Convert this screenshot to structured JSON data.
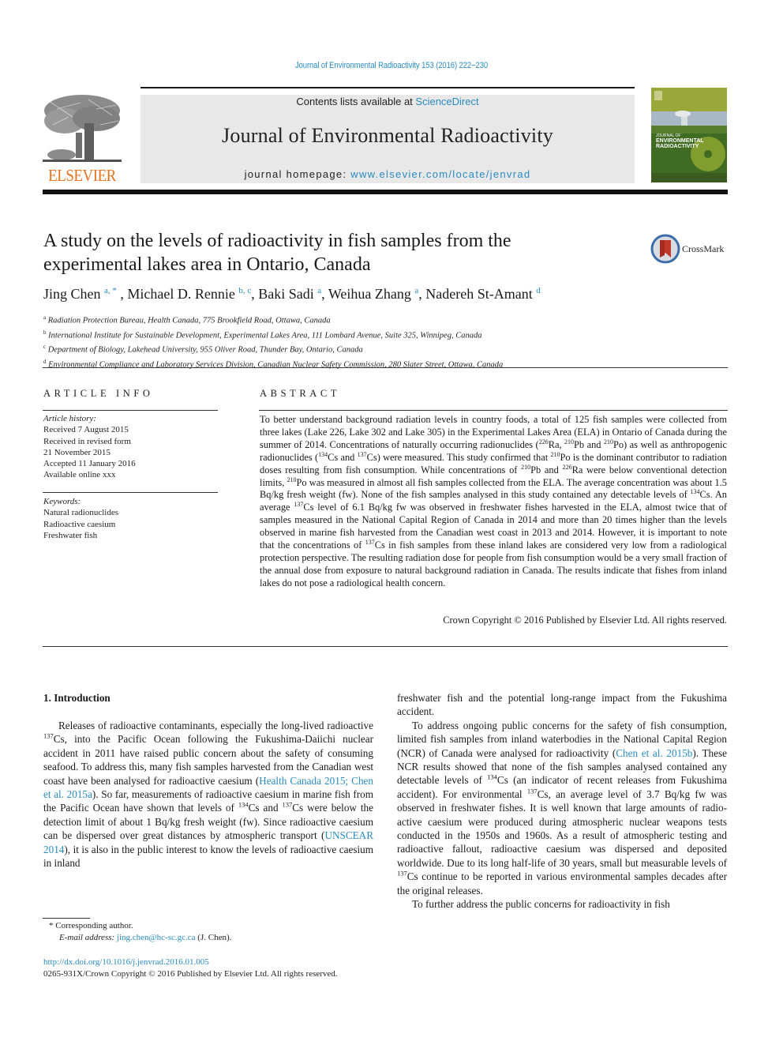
{
  "running_head": "Journal of Environmental Radioactivity 153 (2016) 222−230",
  "header": {
    "publisher_logo_text": "ELSEVIER",
    "contents_prefix": "Contents lists available at ",
    "contents_link": "ScienceDirect",
    "journal_title": "Journal of Environmental Radioactivity",
    "homepage_prefix": "journal homepage: ",
    "homepage_link": "www.elsevier.com/locate/jenvrad",
    "cover_title_line1": "JOURNAL OF",
    "cover_title_line2": "ENVIRONMENTAL",
    "cover_title_line3": "RADIOACTIVITY"
  },
  "article": {
    "title_line1": "A study on the levels of radioactivity in fish samples from the",
    "title_line2": "experimental lakes area in Ontario, Canada",
    "crossmark_label": "CrossMark",
    "authors": [
      {
        "name": "Jing Chen",
        "sup": "a, *"
      },
      {
        "name": "Michael D. Rennie",
        "sup": "b, c"
      },
      {
        "name": "Baki Sadi",
        "sup": "a"
      },
      {
        "name": "Weihua Zhang",
        "sup": "a"
      },
      {
        "name": "Nadereh St-Amant",
        "sup": "d"
      }
    ],
    "affiliations": [
      {
        "key": "a",
        "text": "Radiation Protection Bureau, Health Canada, 775 Brookfield Road, Ottawa, Canada"
      },
      {
        "key": "b",
        "text": "International Institute for Sustainable Development, Experimental Lakes Area, 111 Lombard Avenue, Suite 325, Winnipeg, Canada"
      },
      {
        "key": "c",
        "text": "Department of Biology, Lakehead University, 955 Oliver Road, Thunder Bay, Ontario, Canada"
      },
      {
        "key": "d",
        "text": "Environmental Compliance and Laboratory Services Division, Canadian Nuclear Safety Commission, 280 Slater Street, Ottawa, Canada"
      }
    ]
  },
  "article_info": {
    "heading": "ARTICLE INFO",
    "history_label": "Article history:",
    "history": [
      "Received 7 August 2015",
      "Received in revised form",
      "21 November 2015",
      "Accepted 11 January 2016",
      "Available online xxx"
    ],
    "keywords_label": "Keywords:",
    "keywords": [
      "Natural radionuclides",
      "Radioactive caesium",
      "Freshwater fish"
    ]
  },
  "abstract": {
    "heading": "ABSTRACT",
    "segments": [
      {
        "t": "To better understand background radiation levels in country foods, a total of 125 fish samples were collected from three lakes (Lake 226, Lake 302 and Lake 305) in the Experimental Lakes Area (ELA) in Ontario of Canada during the summer of 2014. Concentrations of naturally occurring radionuclides ("
      },
      {
        "sup": "226"
      },
      {
        "t": "Ra, "
      },
      {
        "sup": "210"
      },
      {
        "t": "Pb and "
      },
      {
        "sup": "210"
      },
      {
        "t": "Po) as well as anthropogenic radionuclides ("
      },
      {
        "sup": "134"
      },
      {
        "t": "Cs and "
      },
      {
        "sup": "137"
      },
      {
        "t": "Cs) were measured. This study confirmed that "
      },
      {
        "sup": "210"
      },
      {
        "t": "Po is the dominant contributor to radiation doses resulting from fish con­sumption. While concentrations of "
      },
      {
        "sup": "210"
      },
      {
        "t": "Pb and "
      },
      {
        "sup": "226"
      },
      {
        "t": "Ra were below conventional detection limits, "
      },
      {
        "sup": "210"
      },
      {
        "t": "Po was measured in almost all fish samples collected from the ELA. The average concentration was about 1.5 Bq/​kg fresh weight (fw). None of the fish samples analysed in this study contained any detectable levels of "
      },
      {
        "sup": "134"
      },
      {
        "t": "Cs. An average "
      },
      {
        "sup": "137"
      },
      {
        "t": "Cs level of 6.1 Bq/kg fw was observed in freshwater fishes harvested in the ELA, almost twice that of samples measured in the National Capital Region of Canada in 2014 and more than 20 times higher than the levels observed in marine fish harvested from the Canadian west coast in 2013 and 2014. However, it is important to note that the concentrations of "
      },
      {
        "sup": "137"
      },
      {
        "t": "Cs in fish samples from these inland lakes are considered very low from a radiological protection perspective. The resulting radiation dose for people from fish consumption would be a very small fraction of the annual dose from exposure to natural background radiation in Canada. The results indicate that fishes from inland lakes do not pose a radiological health concern."
      }
    ],
    "copyright": "Crown Copyright © 2016 Published by Elsevier Ltd. All rights reserved."
  },
  "body": {
    "section_heading": "1.  Introduction",
    "left_paragraphs": [
      [
        {
          "t": "Releases of radioactive contaminants, especially the long-lived radioactive "
        },
        {
          "sup": "137"
        },
        {
          "t": "Cs, into the Pacific Ocean following the Fukushima-Daiichi nuclear accident in 2011 have raised public concern about the safety of consuming seafood. To address this, many fish samples harvested from the Canadian west coast have been analysed for radioactive caesium ("
        },
        {
          "link": "Health Canada 2015; Chen et al. 2015a"
        },
        {
          "t": "). So far, measurements of radioactive caesium in marine fish from the Pa­cific Ocean have shown that levels of "
        },
        {
          "sup": "134"
        },
        {
          "t": "Cs and "
        },
        {
          "sup": "137"
        },
        {
          "t": "Cs were below the detection limit of about 1 Bq/kg fresh weight (fw). Since radioactive caesium can be dispersed over great distances by at­mospheric transport ("
        },
        {
          "link": "UNSCEAR 2014"
        },
        {
          "t": "), it is also in the public in­terest to know the levels of radioactive caesium in inland"
        }
      ]
    ],
    "right_paragraphs": [
      {
        "indent": false,
        "segments": [
          {
            "t": "freshwater fish and the potential long-range impact from the Fukushima accident."
          }
        ]
      },
      {
        "indent": true,
        "segments": [
          {
            "t": "To address ongoing public concerns for the safety of fish con­sumption, limited fish samples from inland waterbodies in the National Capital Region (NCR) of Canada were analysed for radio­activity ("
          },
          {
            "link": "Chen et al. 2015b"
          },
          {
            "t": "). These NCR results showed that none of the fish samples analysed contained any detectable levels of "
          },
          {
            "sup": "134"
          },
          {
            "t": "Cs (an indicator of recent releases from Fukushima accident). For environmental "
          },
          {
            "sup": "137"
          },
          {
            "t": "Cs, an average level of 3.7 Bq/kg fw was observed in freshwater fishes. It is well known that large amounts of radio­active caesium were produced during atmospheric nuclear weapons tests conducted in the 1950s and 1960s. As a result of atmospheric testing and radioactive fallout, radioactive caesium was dispersed and deposited worldwide. Due to its long half-life of 30 years, small but measurable levels of "
          },
          {
            "sup": "137"
          },
          {
            "t": "Cs continue to be re­ported in various environmental samples decades after the original releases."
          }
        ]
      },
      {
        "indent": true,
        "segments": [
          {
            "t": "To further address the public concerns for radioactivity in fish"
          }
        ]
      }
    ]
  },
  "footnotes": {
    "corresponding_marker": "*",
    "corresponding_text": "Corresponding author.",
    "email_label": "E-mail address:",
    "email": "jing.chen@hc-sc.gc.ca",
    "email_suffix": " (J. Chen).",
    "doi": "http://dx.doi.org/10.1016/j.jenvrad.2016.01.005",
    "issn_line": "0265-931X/Crown Copyright © 2016 Published by Elsevier Ltd. All rights reserved."
  },
  "colors": {
    "link": "#2a8bc0",
    "elsevier_orange": "#e9711c",
    "banner_gray": "#e8e8e8",
    "crossmark_red": "#c0392b"
  }
}
